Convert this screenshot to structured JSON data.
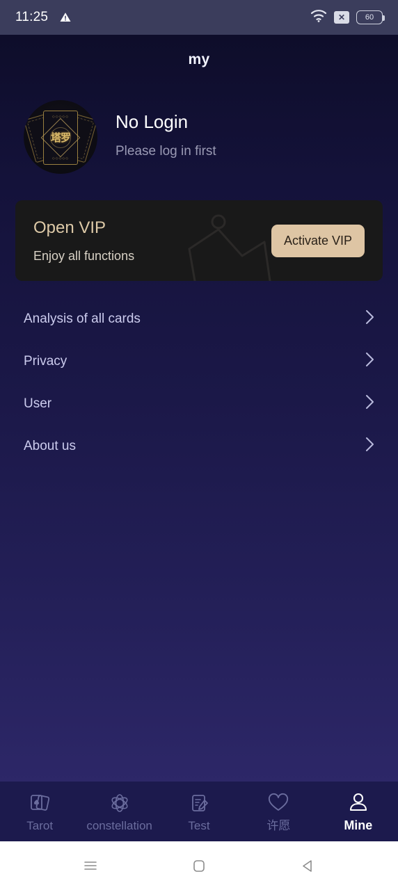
{
  "status_bar": {
    "time": "11:25",
    "warning_icon": "warning-triangle-icon",
    "wifi_icon": "wifi-icon",
    "no_sim_icon": "no-sim-icon",
    "no_sim_glyph": "✕",
    "battery_level": "60"
  },
  "header": {
    "title": "my"
  },
  "profile": {
    "avatar_icon": "tarot-card-avatar",
    "avatar_card_text": "塔罗",
    "avatar_card_tick": "◇◇◇◇◇",
    "name": "No Login",
    "subtitle": "Please log in first"
  },
  "vip": {
    "title": "Open VIP",
    "subtitle": "Enjoy all functions",
    "button_label": "Activate VIP",
    "crown_icon": "crown-icon",
    "card_bg": "#191919",
    "button_bg": "#dec5a4",
    "title_color": "#ddc9a7"
  },
  "menu": {
    "items": [
      {
        "label": "Analysis of all cards",
        "chevron": "chevron-right-icon"
      },
      {
        "label": "Privacy",
        "chevron": "chevron-right-icon"
      },
      {
        "label": "User",
        "chevron": "chevron-right-icon"
      },
      {
        "label": "About us",
        "chevron": "chevron-right-icon"
      }
    ]
  },
  "tabs": {
    "items": [
      {
        "label": "Tarot",
        "icon": "cards-icon",
        "active": false
      },
      {
        "label": "constellation",
        "icon": "atom-icon",
        "active": false
      },
      {
        "label": "Test",
        "icon": "document-edit-icon",
        "active": false
      },
      {
        "label": "许愿",
        "icon": "heart-icon",
        "active": false
      },
      {
        "label": "Mine",
        "icon": "person-icon",
        "active": true
      }
    ],
    "active_color": "#ffffff",
    "inactive_color": "#6b6d9e"
  },
  "nav_bar": {
    "recents_icon": "recents-icon",
    "home_icon": "home-icon",
    "back_icon": "back-icon"
  }
}
